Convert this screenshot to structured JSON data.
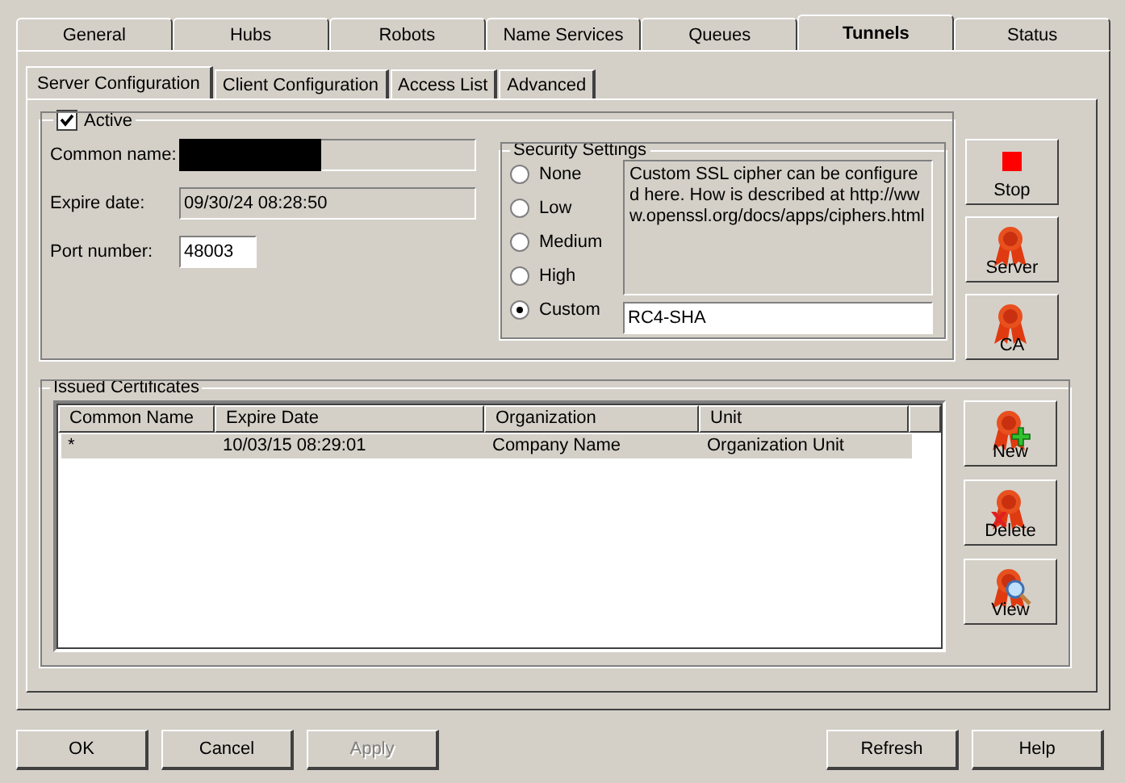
{
  "outer_tabs": [
    {
      "label": "General",
      "selected": false
    },
    {
      "label": "Hubs",
      "selected": false
    },
    {
      "label": "Robots",
      "selected": false
    },
    {
      "label": "Name Services",
      "selected": false
    },
    {
      "label": "Queues",
      "selected": false
    },
    {
      "label": "Tunnels",
      "selected": true
    },
    {
      "label": "Status",
      "selected": false
    }
  ],
  "inner_tabs": [
    {
      "label": "Server Configuration",
      "selected": true
    },
    {
      "label": "Client Configuration",
      "selected": false
    },
    {
      "label": "Access List",
      "selected": false
    },
    {
      "label": "Advanced",
      "selected": false
    }
  ],
  "active": {
    "label": "Active",
    "checked": true
  },
  "fields": [
    {
      "label": "Common name:",
      "redacted": true,
      "readonly": true
    },
    {
      "label": "Expire date:",
      "value": "09/30/24 08:28:50",
      "readonly": true
    },
    {
      "label": "Port number:",
      "value": "48003",
      "readonly": false
    }
  ],
  "security": {
    "title": "Security Settings",
    "options": [
      {
        "label": "None",
        "selected": false
      },
      {
        "label": "Low",
        "selected": false
      },
      {
        "label": "Medium",
        "selected": false
      },
      {
        "label": "High",
        "selected": false
      },
      {
        "label": "Custom",
        "selected": true
      }
    ],
    "description": "Custom SSL cipher can be configured here. How is described at http://www.openssl.org/docs/apps/ciphers.html",
    "cipher": "RC4-SHA"
  },
  "side_buttons": [
    {
      "label": "Stop",
      "kind": "stop"
    },
    {
      "label": "Server",
      "kind": "ribbon"
    },
    {
      "label": "CA",
      "kind": "ribbon"
    }
  ],
  "certificates": {
    "title": "Issued Certificates",
    "columns": [
      "Common Name",
      "Expire Date",
      "Organization",
      "Unit"
    ],
    "rows": [
      {
        "cells": [
          "*",
          "10/03/15 08:29:01",
          "Company Name",
          "Organization Unit"
        ],
        "selected": true
      }
    ]
  },
  "cert_buttons": [
    {
      "label": "New",
      "kind": "ribbon-plus"
    },
    {
      "label": "Delete",
      "kind": "ribbon-x"
    },
    {
      "label": "View",
      "kind": "ribbon-search"
    }
  ],
  "footer": {
    "left": [
      {
        "label": "OK",
        "disabled": false
      },
      {
        "label": "Cancel",
        "disabled": false
      },
      {
        "label": "Apply",
        "disabled": true
      }
    ],
    "right": [
      {
        "label": "Refresh",
        "disabled": false
      },
      {
        "label": "Help",
        "disabled": false
      }
    ]
  }
}
